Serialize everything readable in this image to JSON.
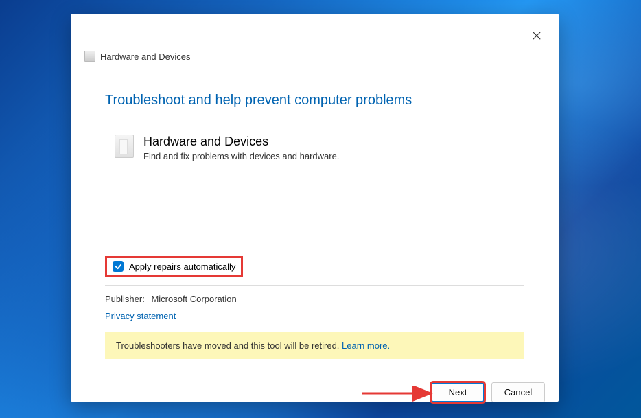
{
  "header": {
    "title": "Hardware and Devices"
  },
  "main": {
    "title": "Troubleshoot and help prevent computer problems",
    "hardware": {
      "title": "Hardware and Devices",
      "description": "Find and fix problems with devices and hardware."
    },
    "checkbox_label": "Apply repairs automatically"
  },
  "meta": {
    "publisher_label": "Publisher:",
    "publisher_value": "Microsoft Corporation",
    "privacy_link": "Privacy statement"
  },
  "notice": {
    "text": "Troubleshooters have moved and this tool will be retired. ",
    "learn_more": "Learn more."
  },
  "buttons": {
    "next": "Next",
    "cancel": "Cancel"
  }
}
